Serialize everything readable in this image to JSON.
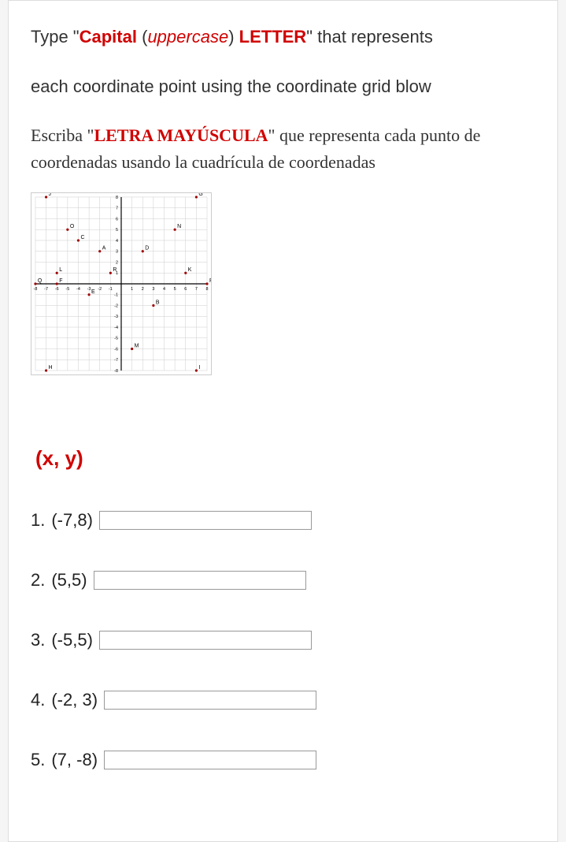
{
  "instruction_en": {
    "pre": "Type \"",
    "cap": "Capital",
    "paren_open": " (",
    "upper": "uppercase",
    "paren_close": ") ",
    "letter": "LETTER",
    "post": "\" that represents",
    "line2": "each coordinate point using the coordinate grid blow"
  },
  "instruction_es": {
    "pre": "Escriba \"",
    "bold": "LETRA MAYÚSCULA",
    "post": "\" que representa cada punto de coordenadas usando la cuadrícula de coordenadas"
  },
  "xy_header": "(x, y)",
  "questions": [
    {
      "num": "1.",
      "coord": "(-7,8)",
      "value": ""
    },
    {
      "num": "2.",
      "coord": "(5,5)",
      "value": ""
    },
    {
      "num": "3.",
      "coord": "(-5,5)",
      "value": ""
    },
    {
      "num": "4.",
      "coord": "(-2, 3)",
      "value": ""
    },
    {
      "num": "5.",
      "coord": "(7, -8)",
      "value": ""
    }
  ],
  "chart_data": {
    "type": "scatter",
    "title": "",
    "xlabel": "",
    "ylabel": "",
    "xlim": [
      -8,
      8
    ],
    "ylim": [
      -8,
      8
    ],
    "x_ticks": [
      -8,
      -7,
      -6,
      -5,
      -4,
      -3,
      -2,
      -1,
      1,
      2,
      3,
      4,
      5,
      6,
      7,
      8
    ],
    "y_ticks": [
      -8,
      -7,
      -6,
      -5,
      -4,
      -3,
      -2,
      -1,
      1,
      2,
      3,
      4,
      5,
      6,
      7,
      8
    ],
    "points": [
      {
        "label": "J",
        "x": -7,
        "y": 8
      },
      {
        "label": "G",
        "x": 7,
        "y": 8
      },
      {
        "label": "O",
        "x": -5,
        "y": 5
      },
      {
        "label": "N",
        "x": 5,
        "y": 5
      },
      {
        "label": "C",
        "x": -4,
        "y": 4
      },
      {
        "label": "A",
        "x": -2,
        "y": 3
      },
      {
        "label": "D",
        "x": 2,
        "y": 3
      },
      {
        "label": "L",
        "x": -6,
        "y": 1
      },
      {
        "label": "R",
        "x": -1,
        "y": 1
      },
      {
        "label": "K",
        "x": 6,
        "y": 1
      },
      {
        "label": "Q",
        "x": -8,
        "y": 0
      },
      {
        "label": "F",
        "x": -6,
        "y": 0
      },
      {
        "label": "P",
        "x": 8,
        "y": 0
      },
      {
        "label": "E",
        "x": -3,
        "y": -1
      },
      {
        "label": "B",
        "x": 3,
        "y": -2
      },
      {
        "label": "M",
        "x": 1,
        "y": -6
      },
      {
        "label": "H",
        "x": -7,
        "y": -8
      },
      {
        "label": "I",
        "x": 7,
        "y": -8
      }
    ]
  }
}
